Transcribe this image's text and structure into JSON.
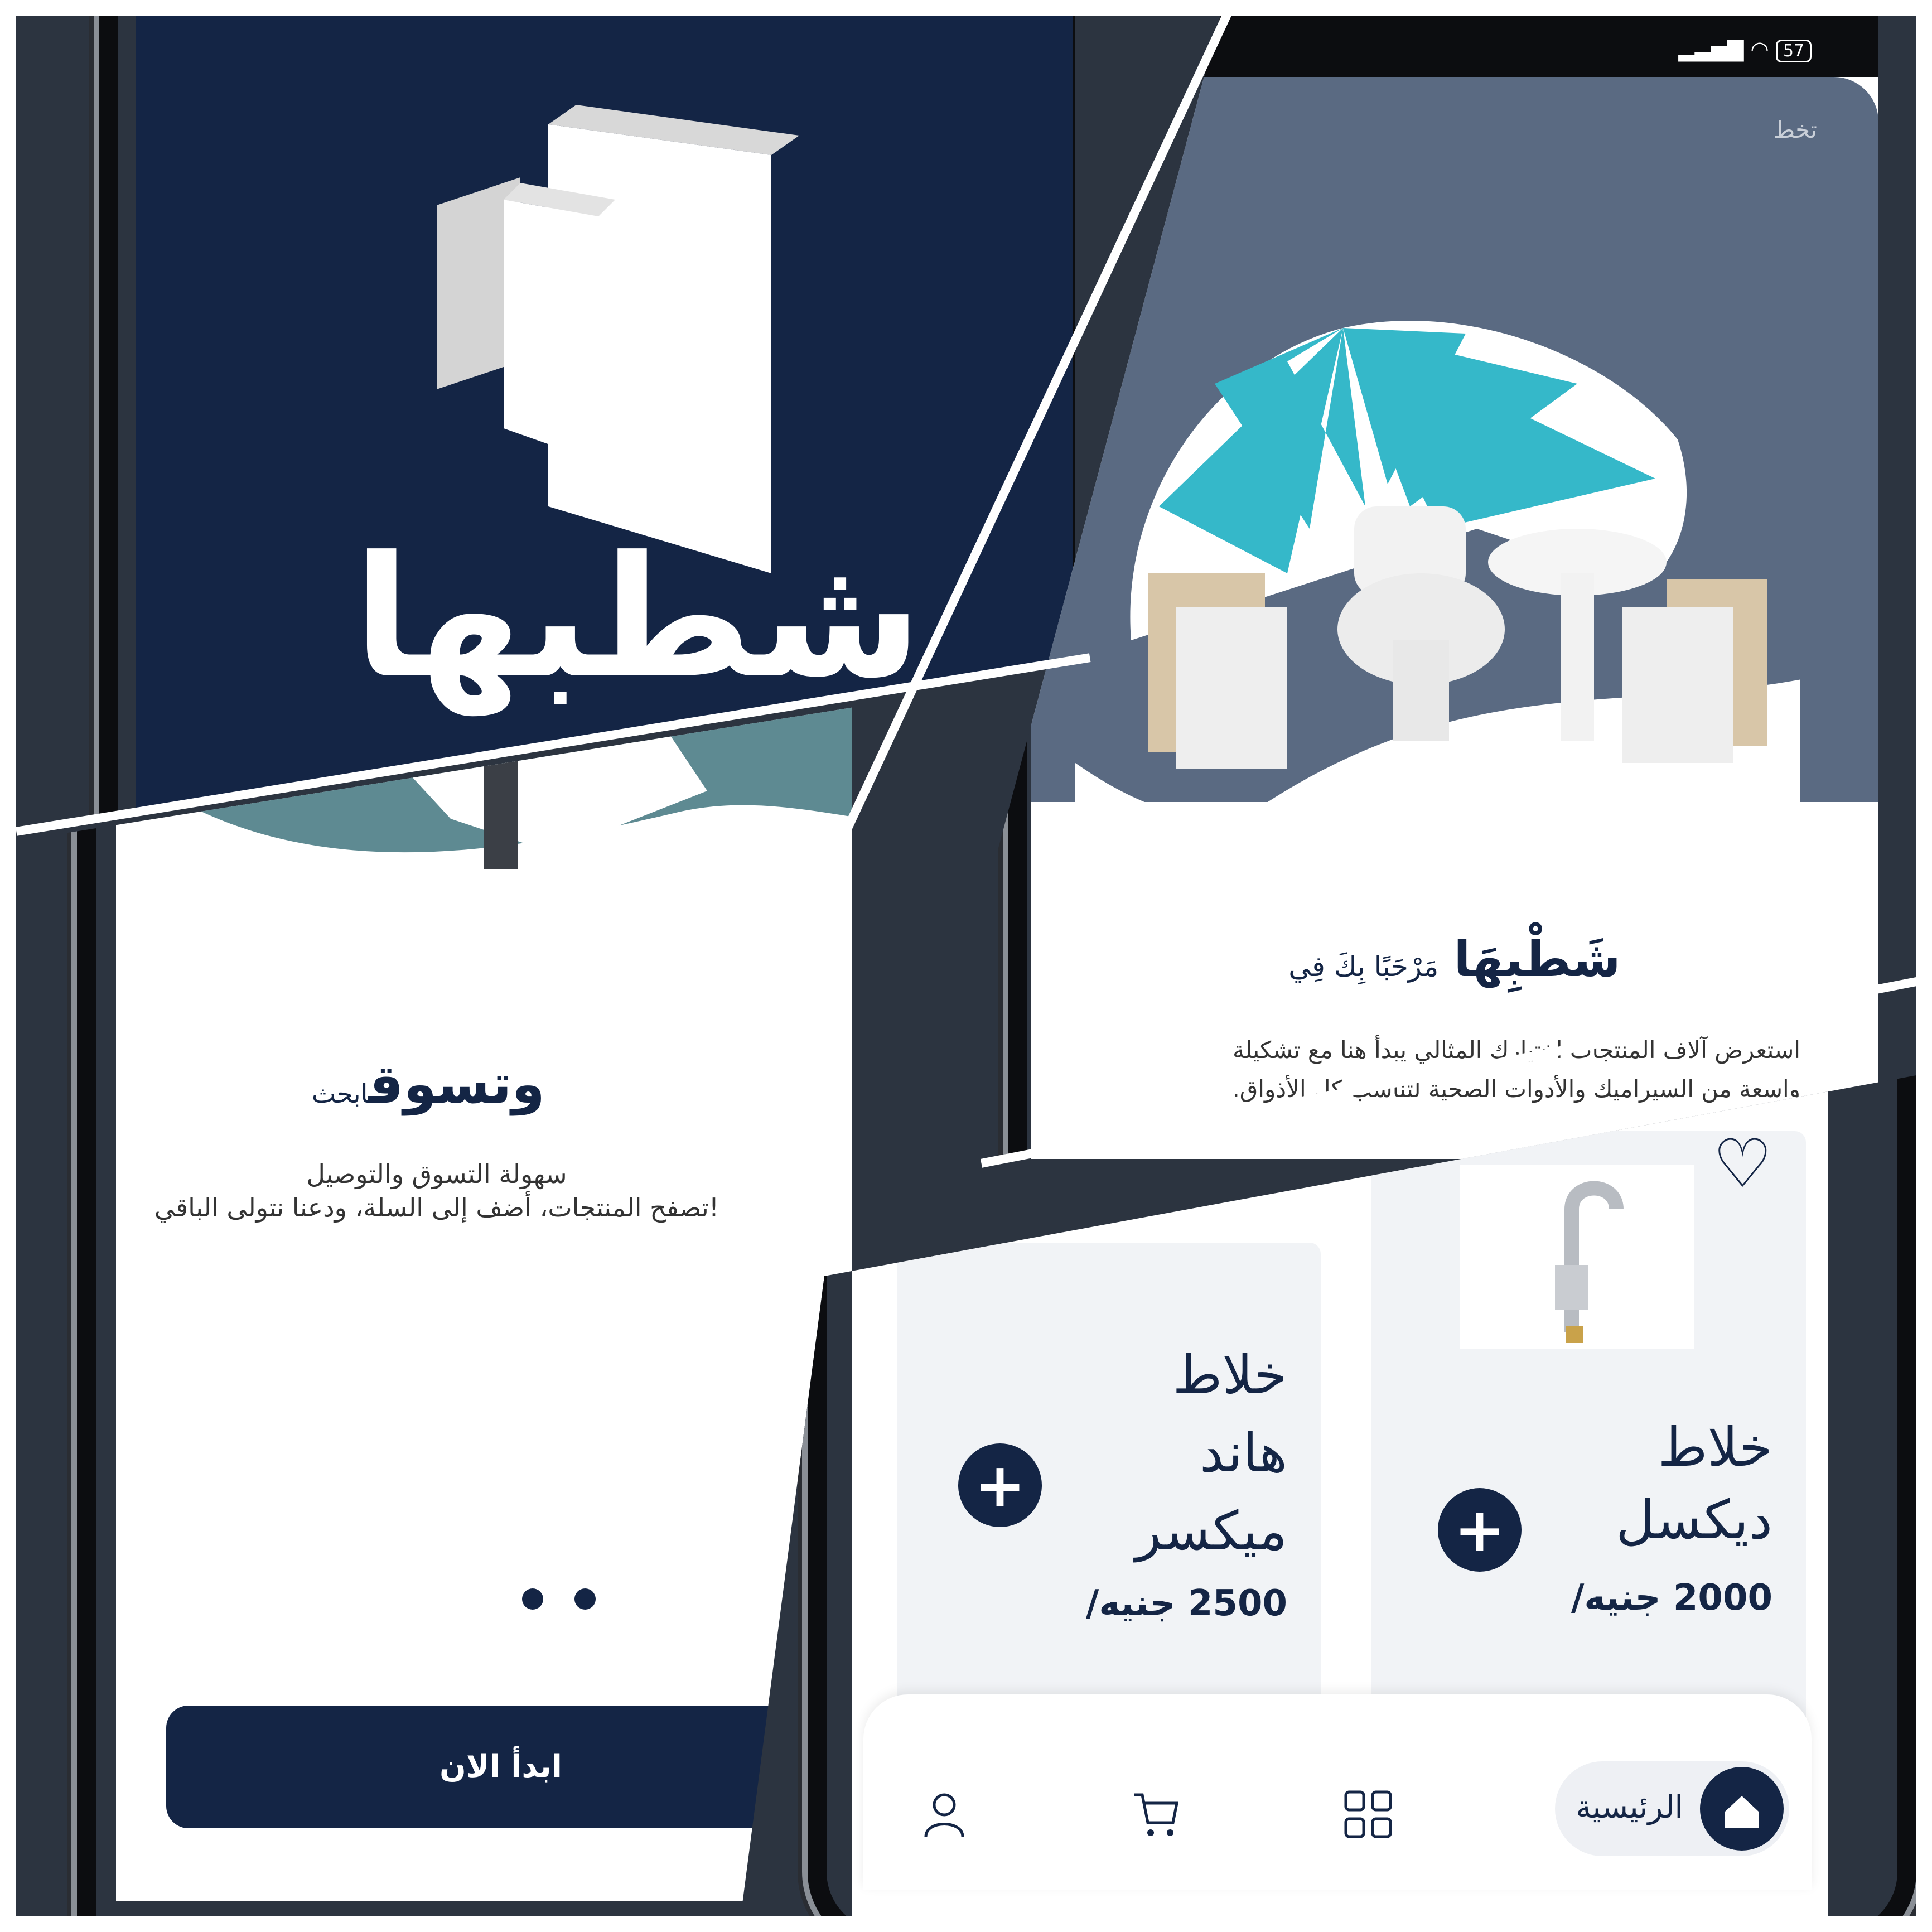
{
  "splash": {
    "brand_name": "شطبها"
  },
  "onboarding": {
    "title_bold": "وتسوق",
    "title_small": "ابحث",
    "subtitle_line1": "سهولة التسوق والتوصيل",
    "subtitle_line2": "تصفح المنتجات، أضف إلى السلة، ودعنا نتولى الباقي!",
    "start_button": "ابدأ الان"
  },
  "welcome": {
    "status_battery": "57",
    "skip_link": "تخط",
    "welcome_small": "مَرْحَبًا بِكَ فِي",
    "welcome_brand": "شَطْبِهَا",
    "description_line1": "استعرض آلاف المنتجات اختيارك المثالي يبدأ هنا مع تشكيلة",
    "description_line2": "واسعة من السيراميك والأدوات الصحية لتناسب كل الأذواق."
  },
  "products": {
    "items": [
      {
        "name_line1": "خلاط",
        "name_line2": "ديكسل",
        "price": "2000 جنيه/"
      },
      {
        "name_line1": "خلاط",
        "name_line2": "هاند",
        "name_line3": "ميكسر",
        "price": "2500 جنيه/"
      }
    ],
    "nav": {
      "home_label": "الرئيسية"
    }
  },
  "colors": {
    "navy": "#142545",
    "slate": "#5a6a82",
    "teal": "#5e8a92",
    "umbrella_cyan": "#35b8c9"
  }
}
